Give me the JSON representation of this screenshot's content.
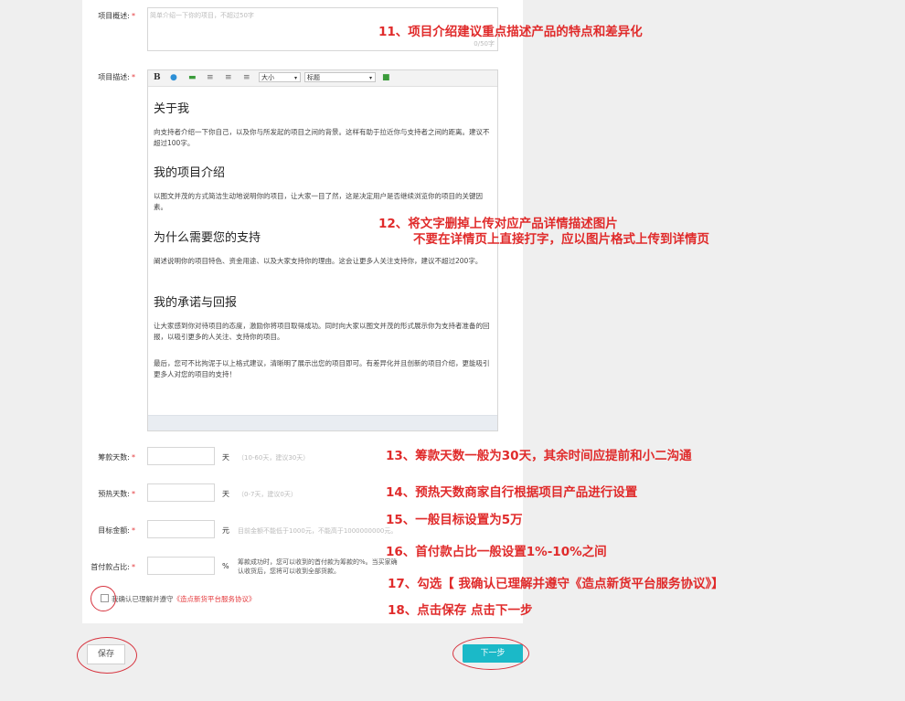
{
  "form": {
    "summary": {
      "label": "项目概述:",
      "required": "*",
      "placeholder": "简单介绍一下你的项目，不超过50字",
      "counter": "0/50字"
    },
    "description": {
      "label": "项目描述:",
      "required": "*",
      "toolbar": {
        "bold": "B",
        "size_select": "大小",
        "heading_select": "标题"
      },
      "content": {
        "h1": "关于我",
        "p1": "向支持者介绍一下你自己，以及你与所发起的项目之间的背景。这样有助于拉近你与支持者之间的距离。建议不超过100字。",
        "h2": "我的项目介绍",
        "p2": "以图文并茂的方式简洁生动地说明你的项目，让大家一目了然，这是决定用户是否继续浏览你的项目的关键因素。",
        "h3": "为什么需要您的支持",
        "p3": "阐述说明你的项目特色、资金用途、以及大家支持你的理由。这会让更多人关注支持你，建议不超过200字。",
        "h4": "我的承诺与回报",
        "p4": "让大家感到你对待项目的态度，激励你将项目取得成功。同时向大家以图文并茂的形式展示你为支持者准备的回报，以吸引更多的人关注、支持你的项目。",
        "p5": "最后，您可不比拘泥于以上格式建议，清晰明了展示出您的项目即可。有差异化并且创新的项目介绍，更能吸引更多人对您的项目的支持！"
      }
    },
    "funding_days": {
      "label": "筹款天数:",
      "required": "*",
      "unit": "天",
      "hint": "（10-60天，建议30天）"
    },
    "preheat_days": {
      "label": "预热天数:",
      "required": "*",
      "unit": "天",
      "hint": "（0-7天，建议0天）"
    },
    "target": {
      "label": "目标金额:",
      "required": "*",
      "unit": "元",
      "hint": "目前金额不能低于1000元，不能高于1000000000元。"
    },
    "down_payment": {
      "label": "首付款占比:",
      "required": "*",
      "unit": "%",
      "hint": "筹款成功时，您可以收到的首付款为筹款的%。当买家确认收货后，您将可以收到全部货款。"
    },
    "agreement": {
      "text": "我确认已理解并遵守",
      "link": "《造点新货平台服务协议》"
    },
    "buttons": {
      "save": "保存",
      "next": "下一步"
    }
  },
  "annotations": {
    "a11": "11、项目介绍建议重点描述产品的特点和差异化",
    "a12_line1": "12、将文字删掉上传对应产品详情描述图片",
    "a12_line2": "不要在详情页上直接打字，应以图片格式上传到详情页",
    "a13": "13、筹款天数一般为30天，其余时间应提前和小二沟通",
    "a14": "14、预热天数商家自行根据项目产品进行设置",
    "a15": "15、一般目标设置为5万",
    "a16": "16、首付款占比一般设置1%-10%之间",
    "a17": "17、勾选【 我确认已理解并遵守《造点新货平台服务协议》】",
    "a18": "18、点击保存 点击下一步"
  },
  "colors": {
    "accent": "#1bb9c8",
    "annotation": "#e02b2b",
    "required": "#e4393c"
  }
}
